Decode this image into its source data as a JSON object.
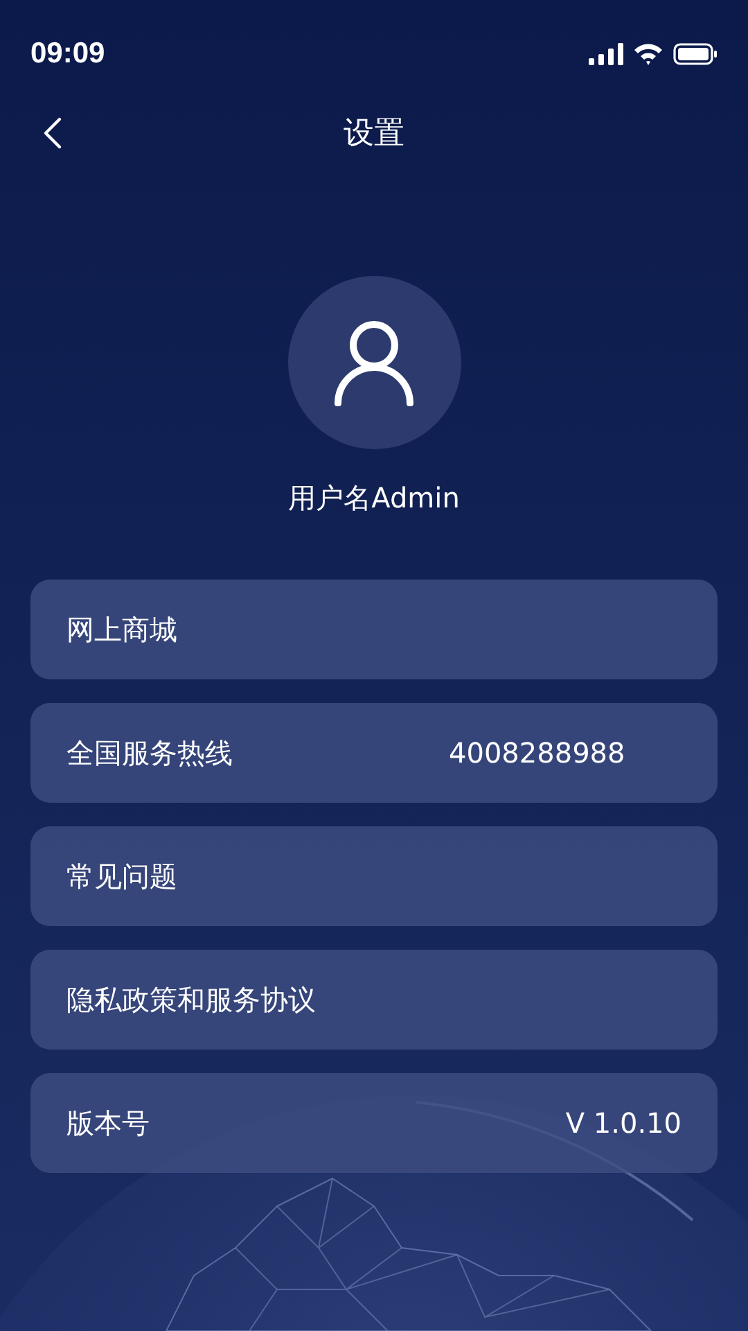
{
  "status_bar": {
    "time": "09:09"
  },
  "nav": {
    "title": "设置"
  },
  "profile": {
    "username": "用户名Admin"
  },
  "items": [
    {
      "kind": "link",
      "label": "网上商城"
    },
    {
      "kind": "phone",
      "label": "全国服务热线",
      "value": "4008288988"
    },
    {
      "kind": "link",
      "label": "常见问题"
    },
    {
      "kind": "link",
      "label": "隐私政策和服务协议"
    },
    {
      "kind": "info",
      "label": "版本号",
      "value": "V 1.0.10"
    }
  ]
}
